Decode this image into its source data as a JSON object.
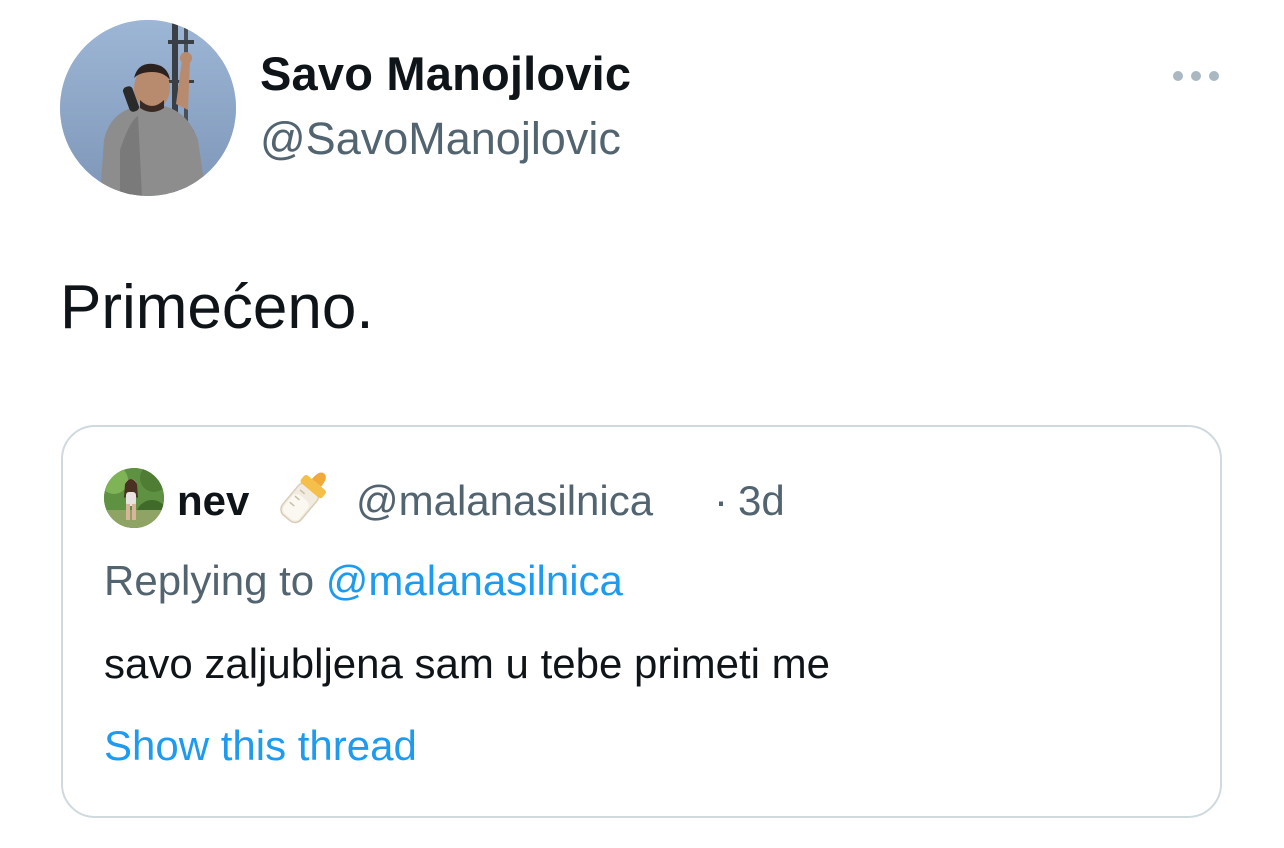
{
  "author": {
    "name": "Savo Manojlovic",
    "handle": "@SavoManojlovic"
  },
  "tweet": {
    "text": "Primećeno."
  },
  "quoted_tweet": {
    "author_name": "nev",
    "name_emoji": "baby-bottle-icon",
    "handle": "@malanasilnica",
    "separator": "·",
    "time": "3d",
    "replying_prefix": "Replying to",
    "replying_handle": "@malanasilnica",
    "text": "savo zaljubljena sam u tebe primeti me",
    "show_thread_label": "Show this thread"
  },
  "icons": {
    "more": "more-options-icon"
  },
  "colors": {
    "text_primary": "#0f1419",
    "text_secondary": "#536471",
    "link": "#1d9bf0",
    "border": "#cfd9de"
  }
}
